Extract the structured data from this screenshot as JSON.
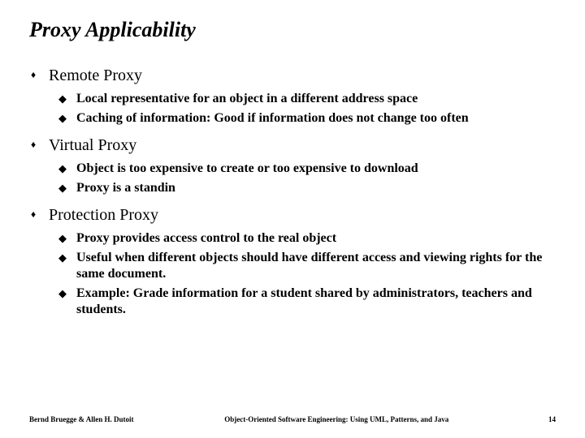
{
  "title": "Proxy Applicability",
  "sections": [
    {
      "heading": "Remote Proxy",
      "items": [
        "Local representative for an object in a different address space",
        "Caching of information: Good if information does not change too often"
      ]
    },
    {
      "heading": "Virtual Proxy",
      "items": [
        "Object is too expensive to create or too expensive to download",
        "Proxy is a standin"
      ]
    },
    {
      "heading": "Protection Proxy",
      "items": [
        "Proxy provides access control to the real object",
        "Useful when different objects should have different access and viewing rights for the same document.",
        "Example: Grade information for a student shared by administrators, teachers and students."
      ]
    }
  ],
  "footer": {
    "left": "Bernd Bruegge & Allen H. Dutoit",
    "center": "Object-Oriented Software Engineering: Using UML, Patterns, and Java",
    "right": "14"
  },
  "bullets": {
    "level1": "♦",
    "level2": "◆"
  }
}
